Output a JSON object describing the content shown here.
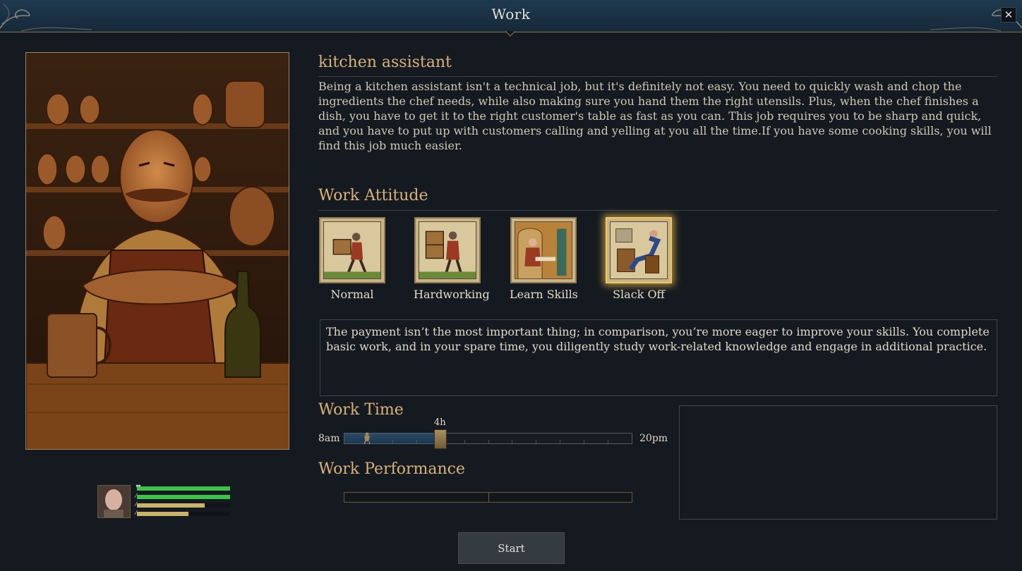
{
  "window": {
    "title": "Work",
    "close_label": "✕"
  },
  "job": {
    "title": "kitchen assistant",
    "description": "Being a kitchen assistant isn't a technical job, but it's definitely not easy. You need to quickly wash and chop the ingredients the chef needs, while also making sure you hand them the right utensils. Plus, when the chef finishes a dish, you have to get it to the right customer's table as fast as you can. This job requires you to be sharp and quick, and you have to put up with customers calling and yelling at you all the time.If you have some cooking skills, you will find this job much easier."
  },
  "work_attitude": {
    "heading": "Work Attitude",
    "options": [
      {
        "label": "Normal",
        "icon": "carrying-crate-icon",
        "selected": false
      },
      {
        "label": "Hardworking",
        "icon": "carrying-stacked-crates-icon",
        "selected": false
      },
      {
        "label": "Learn Skills",
        "icon": "studying-scribe-icon",
        "selected": false
      },
      {
        "label": "Slack Off",
        "icon": "resting-in-chair-icon",
        "selected": true
      }
    ],
    "description": "The payment isn’t the most important thing; in comparison, you’re more eager to improve your skills. You complete basic work, and in your spare time, you diligently study work-related knowledge and engage in additional practice."
  },
  "work_time": {
    "heading": "Work Time",
    "start_label": "8am",
    "end_label": "20pm",
    "value_label": "4h",
    "hours_selected": 4,
    "hours_total": 12
  },
  "work_performance": {
    "heading": "Work Performance",
    "value": 0
  },
  "character": {
    "stats": [
      {
        "name": "health",
        "icon": "heart-icon",
        "fraction": 1.0,
        "color": "#3ec24a"
      },
      {
        "name": "stamina",
        "icon": "sword-icon",
        "fraction": 1.0,
        "color": "#3ec24a"
      },
      {
        "name": "hunger",
        "icon": "food-icon",
        "fraction": 0.73,
        "color": "#c8b46a"
      },
      {
        "name": "mood",
        "icon": "drop-icon",
        "fraction": 0.55,
        "color": "#c8b46a"
      }
    ]
  },
  "actions": {
    "start_label": "Start"
  },
  "colors": {
    "accent": "#d9b27a",
    "selected_glow": "#f0c860",
    "time_fill": "#2a4a66"
  }
}
